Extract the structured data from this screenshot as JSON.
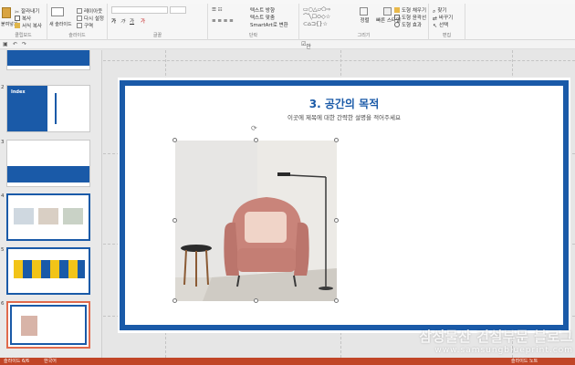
{
  "ribbon": {
    "clipboard": {
      "cut": "잘라내기",
      "copy": "복사",
      "format_copy": "서식 복사",
      "paste": "붙여넣기",
      "label": "클립보드"
    },
    "slides": {
      "new_slide": "새 슬라이드",
      "layout": "레이아웃",
      "reset": "다시 설정",
      "section": "구역",
      "label": "슬라이드"
    },
    "font": {
      "label": "글꼴"
    },
    "paragraph": {
      "text_direction": "텍스트 방향",
      "text_align": "텍스트 맞춤",
      "smartart": "SmartArt로 변환",
      "label": "단락"
    },
    "drawing": {
      "arrange": "정렬",
      "quick_styles": "빠른 스타일",
      "fill": "도형 채우기",
      "outline": "도형 윤곽선",
      "effects": "도형 효과",
      "label": "그리기"
    },
    "editing": {
      "find": "찾기",
      "replace": "바꾸기",
      "select": "선택",
      "label": "편집"
    }
  },
  "qat": {
    "guide": "안내선"
  },
  "slides": [
    {
      "num": "1"
    },
    {
      "num": "2",
      "title": "Index"
    },
    {
      "num": "3"
    },
    {
      "num": "4"
    },
    {
      "num": "5"
    },
    {
      "num": "6"
    }
  ],
  "slide": {
    "title": "3. 공간의 목적",
    "subtitle": "이곳에 제목에 대한 간략한 설명을 적어주세요"
  },
  "status": {
    "slide_info": "슬라이드 6/6",
    "language": "한국어",
    "notes": "슬라이드 노트"
  },
  "watermark": {
    "line1": "삼성물산 건설부문 블로그",
    "line2": "www.samsungblueprint.com"
  },
  "colors": {
    "accent": "#1a5aa8",
    "status_bar": "#c14527",
    "selected_thumb": "#e06a4c"
  }
}
